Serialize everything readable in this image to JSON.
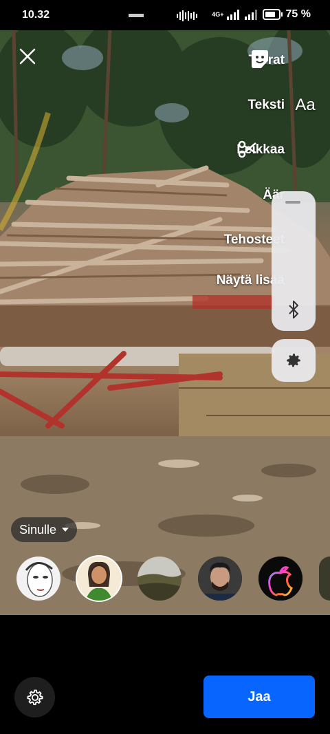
{
  "status_bar": {
    "time": "10.32",
    "network": "4G+",
    "battery": "75 %"
  },
  "editor": {
    "side_menu": [
      {
        "label": "Tarrat",
        "icon": "sticker-icon"
      },
      {
        "label": "Teksti",
        "icon": "text-aa-icon"
      },
      {
        "label": "Leikkaa",
        "icon": "scissors-icon"
      },
      {
        "label": "Äär",
        "icon": "music-icon"
      },
      {
        "label": "Tehosteet",
        "icon": "effects-icon"
      },
      {
        "label": "Näytä lisää",
        "icon": "more-icon"
      }
    ]
  },
  "audience_chip": {
    "label": "Sinulle"
  },
  "avatars": [
    {
      "name": "sketch-face",
      "color": "#e8e8e8"
    },
    {
      "name": "woman-portrait",
      "color": "#4c8a3a"
    },
    {
      "name": "landscape",
      "color": "#6b6b4a"
    },
    {
      "name": "man-portrait",
      "color": "#7a5a48"
    },
    {
      "name": "apple-logo",
      "color": "#111111"
    }
  ],
  "footer": {
    "share_label": "Jaa"
  },
  "colors": {
    "accent": "#0866ff",
    "overlay_panel": "#e9e9ec"
  }
}
